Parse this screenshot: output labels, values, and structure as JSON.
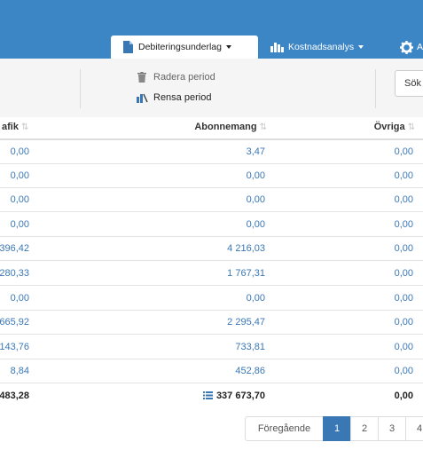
{
  "tabs": [
    {
      "label": "Debiteringsunderlag",
      "icon": "document-icon"
    },
    {
      "label": "Kostnadsanalys",
      "icon": "bar-chart-icon"
    },
    {
      "label": "A",
      "icon": "gear-icon"
    }
  ],
  "toolbar": {
    "delete_period": "Radera period",
    "clear_period": "Rensa period",
    "search_label": "Sök"
  },
  "table": {
    "headers": [
      "afik",
      "Abonnemang",
      "Övriga"
    ],
    "rows": [
      [
        "0,00",
        "3,47",
        "0,00"
      ],
      [
        "0,00",
        "0,00",
        "0,00"
      ],
      [
        "0,00",
        "0,00",
        "0,00"
      ],
      [
        "0,00",
        "0,00",
        "0,00"
      ],
      [
        "396,42",
        "4 216,03",
        "0,00"
      ],
      [
        "280,33",
        "1 767,31",
        "0,00"
      ],
      [
        "0,00",
        "0,00",
        "0,00"
      ],
      [
        "665,92",
        "2 295,47",
        "0,00"
      ],
      [
        "143,76",
        "733,81",
        "0,00"
      ],
      [
        "8,84",
        "452,86",
        "0,00"
      ]
    ],
    "totals": [
      "483,28",
      "337 673,70",
      "0,00"
    ]
  },
  "pagination": {
    "prev": "Föregående",
    "pages": [
      "1",
      "2",
      "3",
      "4"
    ],
    "active_page": "1"
  },
  "colors": {
    "header_bg": "#3d86c6",
    "link": "#3a77b5",
    "active_page": "#3a77b5"
  }
}
